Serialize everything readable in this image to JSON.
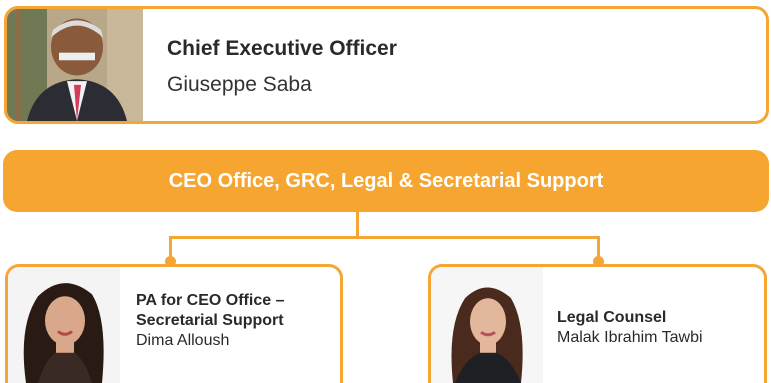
{
  "ceo": {
    "title": "Chief Executive Officer",
    "name": "Giuseppe Saba",
    "photo_icon": "person-portrait"
  },
  "banner": {
    "label": "CEO Office, GRC, Legal & Secretarial Support"
  },
  "pa": {
    "title_line1": "PA for CEO Office –",
    "title_line2": "Secretarial Support",
    "name": "Dima Alloush",
    "photo_icon": "person-portrait"
  },
  "legal": {
    "title": "Legal Counsel",
    "name": "Malak Ibrahim Tawbi",
    "photo_icon": "person-portrait"
  },
  "colors": {
    "accent": "#f4a534",
    "banner": "#f6a630",
    "text": "#2a2a2a"
  }
}
